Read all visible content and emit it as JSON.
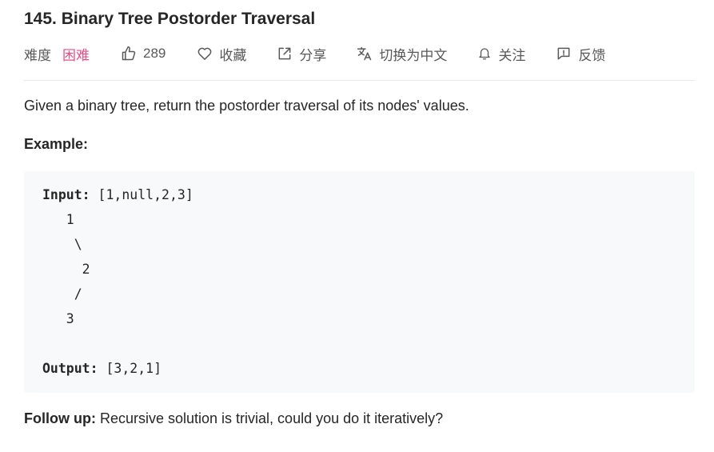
{
  "problem": {
    "title": "145. Binary Tree Postorder Traversal",
    "difficulty_label": "难度",
    "difficulty_value": "困难",
    "difficulty_color": "#ec4c84"
  },
  "actions": {
    "likes": "289",
    "favorite": "收藏",
    "share": "分享",
    "translate": "切换为中文",
    "follow": "关注",
    "feedback": "反馈"
  },
  "icons": {
    "likes": "thumbs-up-icon",
    "favorite": "heart-icon",
    "share": "share-icon",
    "translate": "translate-icon",
    "follow": "bell-icon",
    "feedback": "feedback-icon"
  },
  "content": {
    "description": "Given a binary tree, return the postorder traversal of its nodes' values.",
    "example_heading": "Example:",
    "code": {
      "input_label": "Input:",
      "input_value": " [1,null,2,3]",
      "tree_lines": [
        "   1",
        "    \\",
        "     2",
        "    /",
        "   3"
      ],
      "output_label": "Output:",
      "output_value": " [3,2,1]"
    },
    "followup_label": "Follow up:",
    "followup_text": " Recursive solution is trivial, could you do it iteratively?"
  }
}
